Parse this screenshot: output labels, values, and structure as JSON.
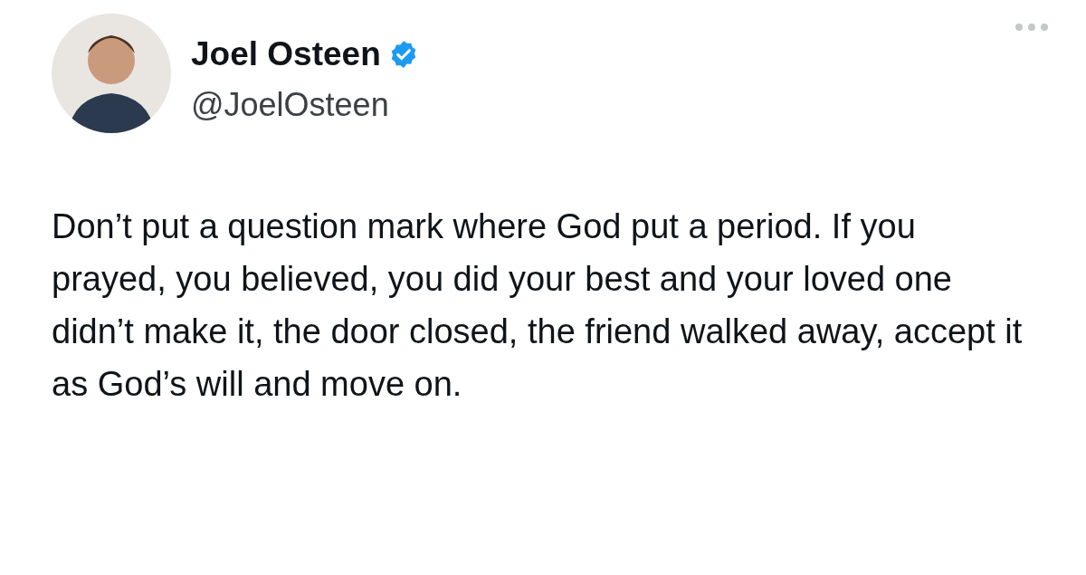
{
  "author": {
    "name": "Joel Osteen",
    "handle": "@JoelOsteen",
    "verified": true
  },
  "tweet": {
    "text": "Don’t put a question mark where God put a period. If you prayed, you believed, you did your best and your loved one didn’t make it, the door closed, the friend walked away, accept it as God’s will and move on."
  }
}
